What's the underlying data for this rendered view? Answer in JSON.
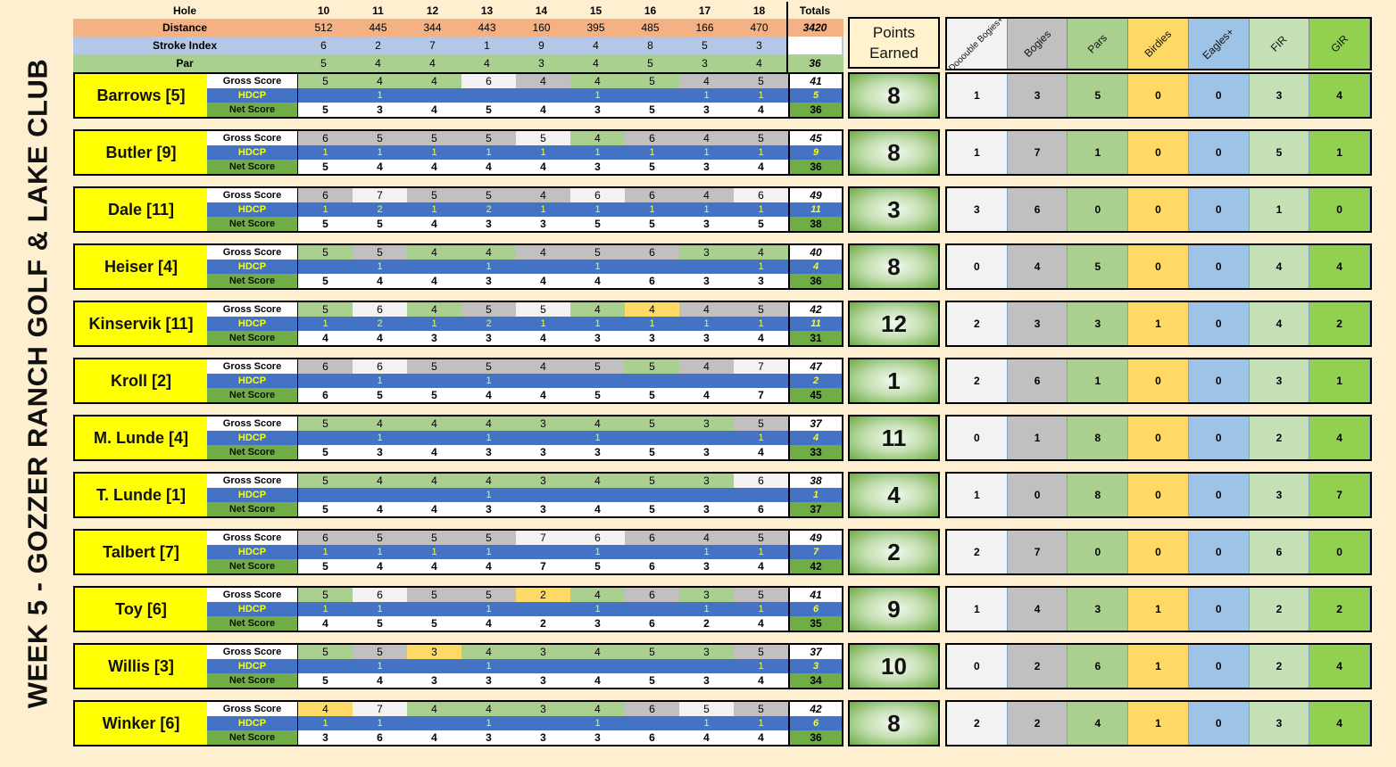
{
  "title": "WEEK 5 - GOZZER RANCH GOLF & LAKE CLUB",
  "course": {
    "hole_label": "Hole",
    "distance_label": "Distance",
    "stroke_index_label": "Stroke Index",
    "par_label": "Par",
    "totals_label": "Totals",
    "holes": [
      "10",
      "11",
      "12",
      "13",
      "14",
      "15",
      "16",
      "17",
      "18"
    ],
    "distance": [
      "512",
      "445",
      "344",
      "443",
      "160",
      "395",
      "485",
      "166",
      "470"
    ],
    "distance_total": "3420",
    "stroke_index": [
      "6",
      "2",
      "7",
      "1",
      "9",
      "4",
      "8",
      "5",
      "3"
    ],
    "par": [
      "5",
      "4",
      "4",
      "4",
      "3",
      "4",
      "5",
      "3",
      "4"
    ],
    "par_total": "36"
  },
  "row_labels": {
    "gross": "Gross Score",
    "hdcp": "HDCP",
    "net": "Net Score"
  },
  "points_header": "Points Earned",
  "stats_headers": [
    "Dooouble Bogies+",
    "Bogies",
    "Pars",
    "Birdies",
    "Eagles+",
    "FIR",
    "GIR"
  ],
  "players": [
    {
      "name": "Barrows [5]",
      "gross": [
        "5",
        "4",
        "4",
        "6",
        "4",
        "4",
        "5",
        "4",
        "5"
      ],
      "gross_total": "41",
      "hdcp": [
        "",
        "1",
        "",
        "",
        "",
        "1",
        "",
        "1",
        "1"
      ],
      "hdcp_total": "5",
      "net": [
        "5",
        "3",
        "4",
        "5",
        "4",
        "3",
        "5",
        "3",
        "4"
      ],
      "net_total": "36",
      "points": "8",
      "stats": [
        "1",
        "3",
        "5",
        "0",
        "0",
        "3",
        "4"
      ]
    },
    {
      "name": "Butler [9]",
      "gross": [
        "6",
        "5",
        "5",
        "5",
        "5",
        "4",
        "6",
        "4",
        "5"
      ],
      "gross_total": "45",
      "hdcp": [
        "1",
        "1",
        "1",
        "1",
        "1",
        "1",
        "1",
        "1",
        "1"
      ],
      "hdcp_total": "9",
      "net": [
        "5",
        "4",
        "4",
        "4",
        "4",
        "3",
        "5",
        "3",
        "4"
      ],
      "net_total": "36",
      "points": "8",
      "stats": [
        "1",
        "7",
        "1",
        "0",
        "0",
        "5",
        "1"
      ]
    },
    {
      "name": "Dale [11]",
      "gross": [
        "6",
        "7",
        "5",
        "5",
        "4",
        "6",
        "6",
        "4",
        "6"
      ],
      "gross_total": "49",
      "hdcp": [
        "1",
        "2",
        "1",
        "2",
        "1",
        "1",
        "1",
        "1",
        "1"
      ],
      "hdcp_total": "11",
      "net": [
        "5",
        "5",
        "4",
        "3",
        "3",
        "5",
        "5",
        "3",
        "5"
      ],
      "net_total": "38",
      "points": "3",
      "stats": [
        "3",
        "6",
        "0",
        "0",
        "0",
        "1",
        "0"
      ]
    },
    {
      "name": "Heiser [4]",
      "gross": [
        "5",
        "5",
        "4",
        "4",
        "4",
        "5",
        "6",
        "3",
        "4"
      ],
      "gross_total": "40",
      "hdcp": [
        "",
        "1",
        "",
        "1",
        "",
        "1",
        "",
        "",
        "1"
      ],
      "hdcp_total": "4",
      "net": [
        "5",
        "4",
        "4",
        "3",
        "4",
        "4",
        "6",
        "3",
        "3"
      ],
      "net_total": "36",
      "points": "8",
      "stats": [
        "0",
        "4",
        "5",
        "0",
        "0",
        "4",
        "4"
      ]
    },
    {
      "name": "Kinservik [11]",
      "gross": [
        "5",
        "6",
        "4",
        "5",
        "5",
        "4",
        "4",
        "4",
        "5"
      ],
      "gross_total": "42",
      "hdcp": [
        "1",
        "2",
        "1",
        "2",
        "1",
        "1",
        "1",
        "1",
        "1"
      ],
      "hdcp_total": "11",
      "net": [
        "4",
        "4",
        "3",
        "3",
        "4",
        "3",
        "3",
        "3",
        "4"
      ],
      "net_total": "31",
      "points": "12",
      "stats": [
        "2",
        "3",
        "3",
        "1",
        "0",
        "4",
        "2"
      ]
    },
    {
      "name": "Kroll [2]",
      "gross": [
        "6",
        "6",
        "5",
        "5",
        "4",
        "5",
        "5",
        "4",
        "7"
      ],
      "gross_total": "47",
      "hdcp": [
        "",
        "1",
        "",
        "1",
        "",
        "",
        "",
        "",
        ""
      ],
      "hdcp_total": "2",
      "net": [
        "6",
        "5",
        "5",
        "4",
        "4",
        "5",
        "5",
        "4",
        "7"
      ],
      "net_total": "45",
      "points": "1",
      "stats": [
        "2",
        "6",
        "1",
        "0",
        "0",
        "3",
        "1"
      ]
    },
    {
      "name": "M. Lunde [4]",
      "gross": [
        "5",
        "4",
        "4",
        "4",
        "3",
        "4",
        "5",
        "3",
        "5"
      ],
      "gross_total": "37",
      "hdcp": [
        "",
        "1",
        "",
        "1",
        "",
        "1",
        "",
        "",
        "1"
      ],
      "hdcp_total": "4",
      "net": [
        "5",
        "3",
        "4",
        "3",
        "3",
        "3",
        "5",
        "3",
        "4"
      ],
      "net_total": "33",
      "points": "11",
      "stats": [
        "0",
        "1",
        "8",
        "0",
        "0",
        "2",
        "4"
      ]
    },
    {
      "name": "T. Lunde [1]",
      "gross": [
        "5",
        "4",
        "4",
        "4",
        "3",
        "4",
        "5",
        "3",
        "6"
      ],
      "gross_total": "38",
      "hdcp": [
        "",
        "",
        "",
        "1",
        "",
        "",
        "",
        "",
        ""
      ],
      "hdcp_total": "1",
      "net": [
        "5",
        "4",
        "4",
        "3",
        "3",
        "4",
        "5",
        "3",
        "6"
      ],
      "net_total": "37",
      "points": "4",
      "stats": [
        "1",
        "0",
        "8",
        "0",
        "0",
        "3",
        "7"
      ]
    },
    {
      "name": "Talbert [7]",
      "gross": [
        "6",
        "5",
        "5",
        "5",
        "7",
        "6",
        "6",
        "4",
        "5"
      ],
      "gross_total": "49",
      "hdcp": [
        "1",
        "1",
        "1",
        "1",
        "",
        "1",
        "",
        "1",
        "1"
      ],
      "hdcp_total": "7",
      "net": [
        "5",
        "4",
        "4",
        "4",
        "7",
        "5",
        "6",
        "3",
        "4"
      ],
      "net_total": "42",
      "points": "2",
      "stats": [
        "2",
        "7",
        "0",
        "0",
        "0",
        "6",
        "0"
      ]
    },
    {
      "name": "Toy [6]",
      "gross": [
        "5",
        "6",
        "5",
        "5",
        "2",
        "4",
        "6",
        "3",
        "5"
      ],
      "gross_total": "41",
      "hdcp": [
        "1",
        "1",
        "",
        "1",
        "",
        "1",
        "",
        "1",
        "1"
      ],
      "hdcp_total": "6",
      "net": [
        "4",
        "5",
        "5",
        "4",
        "2",
        "3",
        "6",
        "2",
        "4"
      ],
      "net_total": "35",
      "points": "9",
      "stats": [
        "1",
        "4",
        "3",
        "1",
        "0",
        "2",
        "2"
      ]
    },
    {
      "name": "Willis [3]",
      "gross": [
        "5",
        "5",
        "3",
        "4",
        "3",
        "4",
        "5",
        "3",
        "5"
      ],
      "gross_total": "37",
      "hdcp": [
        "",
        "1",
        "",
        "1",
        "",
        "",
        "",
        "",
        "1"
      ],
      "hdcp_total": "3",
      "net": [
        "5",
        "4",
        "3",
        "3",
        "3",
        "4",
        "5",
        "3",
        "4"
      ],
      "net_total": "34",
      "points": "10",
      "stats": [
        "0",
        "2",
        "6",
        "1",
        "0",
        "2",
        "4"
      ]
    },
    {
      "name": "Winker [6]",
      "gross": [
        "4",
        "7",
        "4",
        "4",
        "3",
        "4",
        "6",
        "5",
        "5"
      ],
      "gross_total": "42",
      "hdcp": [
        "1",
        "1",
        "",
        "1",
        "",
        "1",
        "",
        "1",
        "1"
      ],
      "hdcp_total": "6",
      "net": [
        "3",
        "6",
        "4",
        "3",
        "3",
        "3",
        "6",
        "4",
        "4"
      ],
      "net_total": "36",
      "points": "8",
      "stats": [
        "2",
        "2",
        "4",
        "1",
        "0",
        "3",
        "4"
      ]
    }
  ]
}
